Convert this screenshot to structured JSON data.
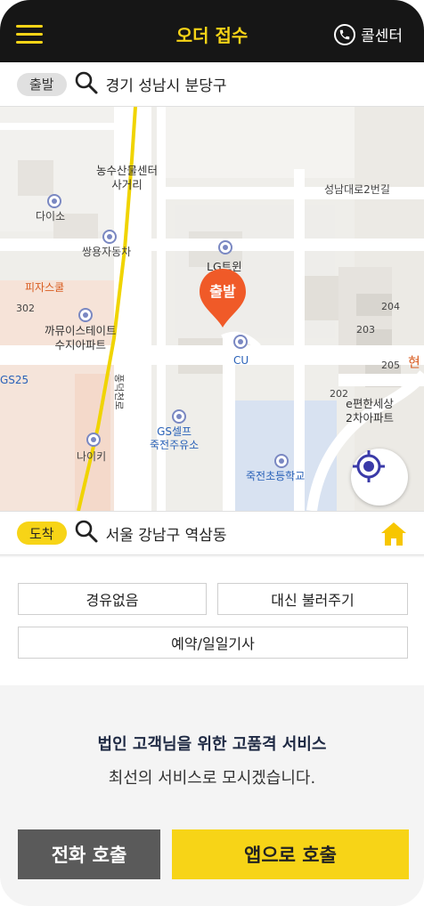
{
  "header": {
    "menu_icon": "hamburger-icon",
    "title": "오더 접수",
    "call_center_label": "콜센터",
    "call_icon": "phone-icon"
  },
  "departure": {
    "tag": "출발",
    "address": "경기 성남시 분당구"
  },
  "arrival": {
    "tag": "도착",
    "address": "서울 강남구 역삼동"
  },
  "map": {
    "marker_label": "출발",
    "labels": {
      "nonghyup": "농수산물센터\n사거리",
      "daiso": "다이소",
      "ssangyong": "쌍용자동차",
      "pizza": "피자스쿨",
      "kkamyu": "까뮤이스테이트\n수지아파트",
      "lgtwin": "LG트윈",
      "cu": "CU",
      "gs25": "GS25",
      "nike": "나이키",
      "gself": "GS셀프\n죽전주유소",
      "school": "죽전초등학교",
      "seongnam_road": "성남대로2번길",
      "e_pyeonhan": "e편한세상\n2차아파트",
      "road_vertical": "풍덕천로",
      "n204": "204",
      "n203": "203",
      "n205": "205",
      "n202": "202",
      "n302": "302",
      "hyun": "현"
    }
  },
  "options": {
    "no_fuel": "경유없음",
    "proxy_call": "대신 불러주기",
    "reservation": "예약/일일기사"
  },
  "promo": {
    "title": "법인 고객님을 위한 고품격 서비스",
    "subtitle": "최선의 서비스로 모시겠습니다."
  },
  "buttons": {
    "phone_call": "전화 호출",
    "app_call": "앱으로 호출"
  },
  "colors": {
    "accent": "#f7d417",
    "header_bg": "#161616",
    "marker": "#f05a28"
  }
}
